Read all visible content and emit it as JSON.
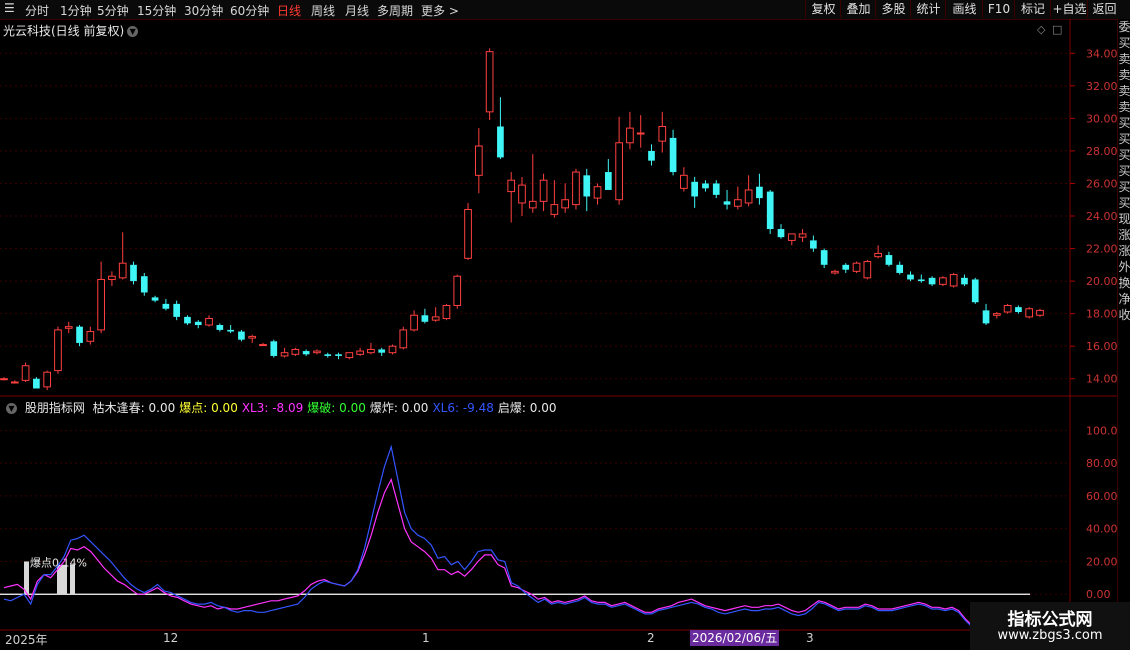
{
  "toolbar": {
    "periods": [
      "分时",
      "1分钟",
      "5分钟",
      "15分钟",
      "30分钟",
      "60分钟",
      "日线",
      "周线",
      "月线",
      "多周期",
      "更多 >"
    ],
    "active": "日线",
    "right_buttons": [
      "复权",
      "叠加",
      "多股",
      "统计",
      "画线",
      "F10",
      "标记",
      "+自选",
      "返回"
    ]
  },
  "stock": {
    "title": "光云科技(日线 前复权)"
  },
  "price_axis": {
    "ticks": [
      "34.00",
      "32.00",
      "30.00",
      "28.00",
      "26.00",
      "24.00",
      "22.00",
      "20.00",
      "18.00",
      "16.00",
      "14.00"
    ]
  },
  "indicator": {
    "name": "股朋指标网",
    "values": [
      {
        "label": "枯木逢春:",
        "value": "0.00",
        "color": "#e8e8e8"
      },
      {
        "label": "爆点:",
        "value": "0.00",
        "color": "#ffff33"
      },
      {
        "label": "XL3:",
        "value": "-8.09",
        "color": "#ff33ff"
      },
      {
        "label": "爆破:",
        "value": "0.00",
        "color": "#33ff33"
      },
      {
        "label": "爆炸:",
        "value": "0.00",
        "color": "#e8e8e8"
      },
      {
        "label": "XL6:",
        "value": "-9.48",
        "color": "#3355ff"
      },
      {
        "label": "启爆:",
        "value": "0.00",
        "color": "#e8e8e8"
      }
    ],
    "axis_ticks": [
      "100.0",
      "80.00",
      "60.00",
      "40.00",
      "20.00",
      "0.00"
    ],
    "annotation": "爆点0.14%"
  },
  "date_axis": {
    "labels": [
      "2025年",
      "12",
      "1",
      "2",
      "3"
    ],
    "cursor_date": "2026/02/06/五"
  },
  "right_edge_chars": [
    "委",
    "买",
    "卖",
    "卖",
    "卖",
    "卖",
    "买",
    "买",
    "买",
    "买",
    "买",
    "买",
    "现",
    "涨",
    "涨",
    "外",
    "换",
    "净",
    "收"
  ],
  "watermark": {
    "line1": "指标公式网",
    "line2": "www.zbgs3.com"
  },
  "chart_data": {
    "type": "candlestick",
    "ylim": [
      13.0,
      35.0
    ],
    "candles": [
      [
        14.0,
        14.1,
        13.9,
        14.0
      ],
      [
        13.8,
        13.9,
        13.7,
        13.8
      ],
      [
        13.9,
        15.0,
        13.8,
        14.8
      ],
      [
        14.0,
        14.1,
        13.4,
        13.4
      ],
      [
        13.5,
        14.5,
        13.3,
        14.4
      ],
      [
        14.5,
        17.2,
        14.3,
        17.0
      ],
      [
        17.1,
        17.5,
        16.8,
        17.2
      ],
      [
        17.2,
        17.3,
        16.0,
        16.2
      ],
      [
        16.3,
        17.2,
        16.1,
        16.9
      ],
      [
        17.0,
        21.2,
        16.8,
        20.1
      ],
      [
        20.1,
        20.6,
        19.7,
        20.3
      ],
      [
        20.2,
        23.0,
        20.1,
        21.1
      ],
      [
        21.0,
        21.2,
        19.8,
        20.0
      ],
      [
        20.3,
        20.5,
        19.1,
        19.3
      ],
      [
        19.0,
        19.1,
        18.7,
        18.8
      ],
      [
        18.6,
        18.9,
        18.2,
        18.3
      ],
      [
        18.6,
        18.8,
        17.6,
        17.8
      ],
      [
        17.8,
        17.9,
        17.3,
        17.4
      ],
      [
        17.5,
        17.6,
        17.1,
        17.3
      ],
      [
        17.3,
        17.9,
        17.2,
        17.7
      ],
      [
        17.3,
        17.4,
        16.9,
        17.0
      ],
      [
        17.0,
        17.3,
        16.8,
        16.9
      ],
      [
        16.9,
        17.0,
        16.3,
        16.4
      ],
      [
        16.5,
        16.7,
        16.2,
        16.6
      ],
      [
        16.1,
        16.2,
        16.0,
        16.1
      ],
      [
        16.3,
        16.4,
        15.3,
        15.4
      ],
      [
        15.4,
        15.9,
        15.3,
        15.6
      ],
      [
        15.5,
        15.9,
        15.4,
        15.8
      ],
      [
        15.7,
        15.8,
        15.4,
        15.5
      ],
      [
        15.6,
        15.8,
        15.5,
        15.7
      ],
      [
        15.5,
        15.6,
        15.3,
        15.4
      ],
      [
        15.5,
        15.6,
        15.2,
        15.4
      ],
      [
        15.3,
        15.6,
        15.2,
        15.6
      ],
      [
        15.5,
        15.9,
        15.4,
        15.7
      ],
      [
        15.6,
        16.2,
        15.5,
        15.8
      ],
      [
        15.8,
        15.9,
        15.4,
        15.6
      ],
      [
        15.6,
        16.1,
        15.5,
        16.0
      ],
      [
        15.9,
        17.2,
        15.8,
        17.0
      ],
      [
        17.0,
        18.2,
        16.9,
        17.9
      ],
      [
        17.9,
        18.3,
        17.4,
        17.5
      ],
      [
        17.6,
        18.4,
        17.5,
        17.8
      ],
      [
        17.7,
        18.6,
        17.6,
        18.5
      ],
      [
        18.5,
        20.4,
        18.3,
        20.3
      ],
      [
        21.4,
        24.8,
        21.3,
        24.4
      ],
      [
        26.5,
        29.4,
        25.4,
        28.3
      ],
      [
        30.4,
        34.3,
        29.9,
        34.1
      ],
      [
        29.5,
        31.3,
        27.5,
        27.6
      ],
      [
        25.5,
        26.7,
        23.6,
        26.2
      ],
      [
        24.8,
        26.4,
        24.0,
        25.9
      ],
      [
        24.5,
        27.8,
        24.2,
        24.9
      ],
      [
        24.9,
        26.6,
        24.3,
        26.2
      ],
      [
        24.1,
        26.2,
        23.9,
        24.7
      ],
      [
        24.5,
        26.0,
        24.2,
        25.0
      ],
      [
        24.7,
        26.9,
        24.4,
        26.7
      ],
      [
        26.5,
        26.9,
        24.3,
        25.2
      ],
      [
        25.1,
        26.0,
        24.7,
        25.8
      ],
      [
        26.7,
        27.5,
        25.8,
        25.6
      ],
      [
        25.0,
        30.1,
        24.7,
        28.5
      ],
      [
        28.5,
        30.4,
        28.1,
        29.4
      ],
      [
        29.1,
        30.2,
        28.2,
        29.1
      ],
      [
        28.0,
        28.4,
        27.1,
        27.4
      ],
      [
        28.6,
        30.4,
        27.9,
        29.5
      ],
      [
        28.8,
        29.3,
        26.5,
        26.7
      ],
      [
        25.7,
        27.0,
        25.5,
        26.5
      ],
      [
        26.1,
        26.4,
        24.5,
        25.2
      ],
      [
        26.0,
        26.2,
        25.5,
        25.7
      ],
      [
        26.0,
        26.2,
        25.1,
        25.3
      ],
      [
        24.9,
        25.6,
        24.4,
        24.7
      ],
      [
        24.6,
        25.8,
        24.4,
        25.0
      ],
      [
        24.8,
        26.5,
        24.6,
        25.6
      ],
      [
        25.8,
        26.6,
        24.7,
        25.1
      ],
      [
        25.5,
        25.6,
        22.9,
        23.2
      ],
      [
        23.2,
        23.5,
        22.6,
        22.7
      ],
      [
        22.5,
        22.9,
        22.2,
        22.9
      ],
      [
        22.7,
        23.2,
        22.4,
        22.9
      ],
      [
        22.5,
        22.8,
        21.8,
        22.0
      ],
      [
        21.9,
        22.0,
        20.8,
        21.0
      ],
      [
        20.5,
        20.7,
        20.4,
        20.6
      ],
      [
        21.0,
        21.1,
        20.5,
        20.7
      ],
      [
        20.6,
        21.2,
        20.5,
        21.1
      ],
      [
        20.2,
        21.3,
        20.1,
        21.2
      ],
      [
        21.5,
        22.2,
        21.4,
        21.7
      ],
      [
        21.6,
        21.8,
        20.9,
        21.0
      ],
      [
        21.0,
        21.2,
        20.4,
        20.5
      ],
      [
        20.4,
        20.6,
        20.0,
        20.1
      ],
      [
        20.1,
        20.4,
        19.9,
        20.0
      ],
      [
        20.2,
        20.3,
        19.7,
        19.8
      ],
      [
        19.8,
        20.3,
        19.7,
        20.2
      ],
      [
        19.7,
        20.5,
        19.6,
        20.4
      ],
      [
        20.2,
        20.4,
        19.7,
        19.8
      ],
      [
        20.1,
        20.2,
        18.6,
        18.7
      ],
      [
        18.2,
        18.6,
        17.3,
        17.4
      ],
      [
        17.9,
        18.1,
        17.7,
        18.0
      ],
      [
        18.1,
        18.6,
        18.0,
        18.5
      ],
      [
        18.4,
        18.5,
        18.0,
        18.1
      ],
      [
        17.8,
        18.4,
        17.7,
        18.3
      ],
      [
        17.9,
        18.3,
        17.8,
        18.2
      ]
    ],
    "indicator_series": [
      {
        "name": "XL3",
        "color": "#ff33ff",
        "values": [
          4,
          5,
          6,
          3,
          -3,
          8,
          12,
          10,
          15,
          20,
          28,
          27,
          29,
          26,
          21,
          16,
          12,
          8,
          6,
          3,
          0,
          0,
          2,
          4,
          1,
          -1,
          -2,
          -4,
          -6,
          -7,
          -8,
          -7,
          -9,
          -8,
          -9,
          -9,
          -8,
          -7,
          -6,
          -5,
          -4,
          -4,
          -3,
          -2,
          -1,
          2,
          6,
          8,
          9,
          7,
          6,
          5,
          8,
          14,
          24,
          36,
          50,
          62,
          70,
          55,
          40,
          32,
          29,
          26,
          22,
          15,
          15,
          12,
          14,
          11,
          15,
          20,
          24,
          24,
          18,
          16,
          5,
          4,
          2,
          0,
          -3,
          -2,
          -5,
          -4,
          -5,
          -4,
          -3,
          -1,
          -4,
          -5,
          -5,
          -7,
          -6,
          -5,
          -7,
          -9,
          -11,
          -11,
          -9,
          -8,
          -7,
          -5,
          -4,
          -3,
          -5,
          -7,
          -8,
          -9,
          -10,
          -9,
          -8,
          -7,
          -8,
          -8,
          -7,
          -7,
          -6,
          -8,
          -10,
          -11,
          -10,
          -7,
          -4,
          -5,
          -7,
          -9,
          -8,
          -8,
          -8,
          -6,
          -7,
          -9,
          -9,
          -9,
          -8,
          -7,
          -6,
          -5,
          -6,
          -8,
          -8,
          -9,
          -8,
          -10,
          -15,
          -19
        ]
      },
      {
        "name": "XL6",
        "color": "#3355ff",
        "values": [
          -3,
          -4,
          -2,
          0,
          -6,
          6,
          12,
          12,
          17,
          23,
          33,
          34,
          36,
          32,
          28,
          24,
          20,
          15,
          10,
          6,
          3,
          1,
          3,
          6,
          2,
          1,
          -1,
          -3,
          -5,
          -6,
          -6,
          -5,
          -7,
          -8,
          -10,
          -11,
          -10,
          -10,
          -11,
          -11,
          -10,
          -9,
          -8,
          -7,
          -6,
          -2,
          3,
          6,
          8,
          7,
          6,
          5,
          8,
          15,
          28,
          45,
          62,
          78,
          90,
          70,
          50,
          40,
          36,
          34,
          30,
          22,
          23,
          18,
          20,
          15,
          20,
          26,
          27,
          27,
          21,
          20,
          7,
          5,
          1,
          -2,
          -5,
          -3,
          -6,
          -5,
          -6,
          -5,
          -4,
          -2,
          -5,
          -6,
          -6,
          -8,
          -7,
          -6,
          -8,
          -10,
          -12,
          -12,
          -10,
          -9,
          -8,
          -7,
          -6,
          -5,
          -6,
          -8,
          -9,
          -11,
          -12,
          -11,
          -10,
          -9,
          -10,
          -10,
          -9,
          -9,
          -8,
          -10,
          -12,
          -13,
          -12,
          -9,
          -5,
          -6,
          -8,
          -10,
          -9,
          -9,
          -9,
          -7,
          -8,
          -10,
          -10,
          -10,
          -9,
          -8,
          -7,
          -6,
          -7,
          -9,
          -9,
          -10,
          -9,
          -11,
          -16,
          -20
        ]
      }
    ],
    "indicator_ylim": [
      -20,
      110
    ]
  }
}
